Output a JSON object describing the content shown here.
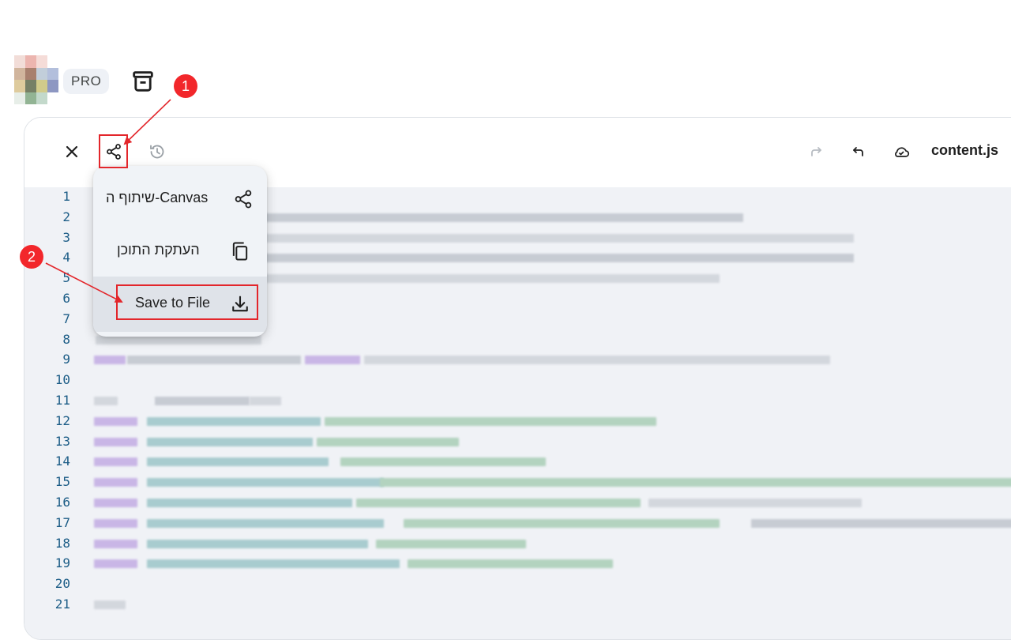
{
  "header": {
    "pro_label": "PRO",
    "avatar_icon": "pixelated-avatar",
    "archive_icon": "archive-icon"
  },
  "canvas": {
    "filename": "content.js",
    "toolbar_icons": [
      "close-icon",
      "share-icon",
      "history-icon",
      "redo-icon",
      "undo-icon",
      "cloud-saved-icon"
    ],
    "line_numbers": [
      "1",
      "2",
      "3",
      "4",
      "5",
      "6",
      "7",
      "8",
      "9",
      "10",
      "11",
      "12",
      "13",
      "14",
      "15",
      "16",
      "17",
      "18",
      "19",
      "20",
      "21"
    ]
  },
  "share_menu": {
    "items": [
      {
        "label": "שיתוף ה-Canvas",
        "icon": "share-icon"
      },
      {
        "label": "העתקת התוכן",
        "icon": "copy-icon"
      },
      {
        "label": "Save to File",
        "icon": "download-icon"
      }
    ]
  },
  "annotations": {
    "step1": "1",
    "step2": "2",
    "color": "#e3262b"
  },
  "colors": {
    "editor_bg": "#f0f2f6",
    "line_number": "#1b5c86",
    "menu_bg": "#f0f3f7",
    "menu_highlight": "#dfe3e9"
  }
}
